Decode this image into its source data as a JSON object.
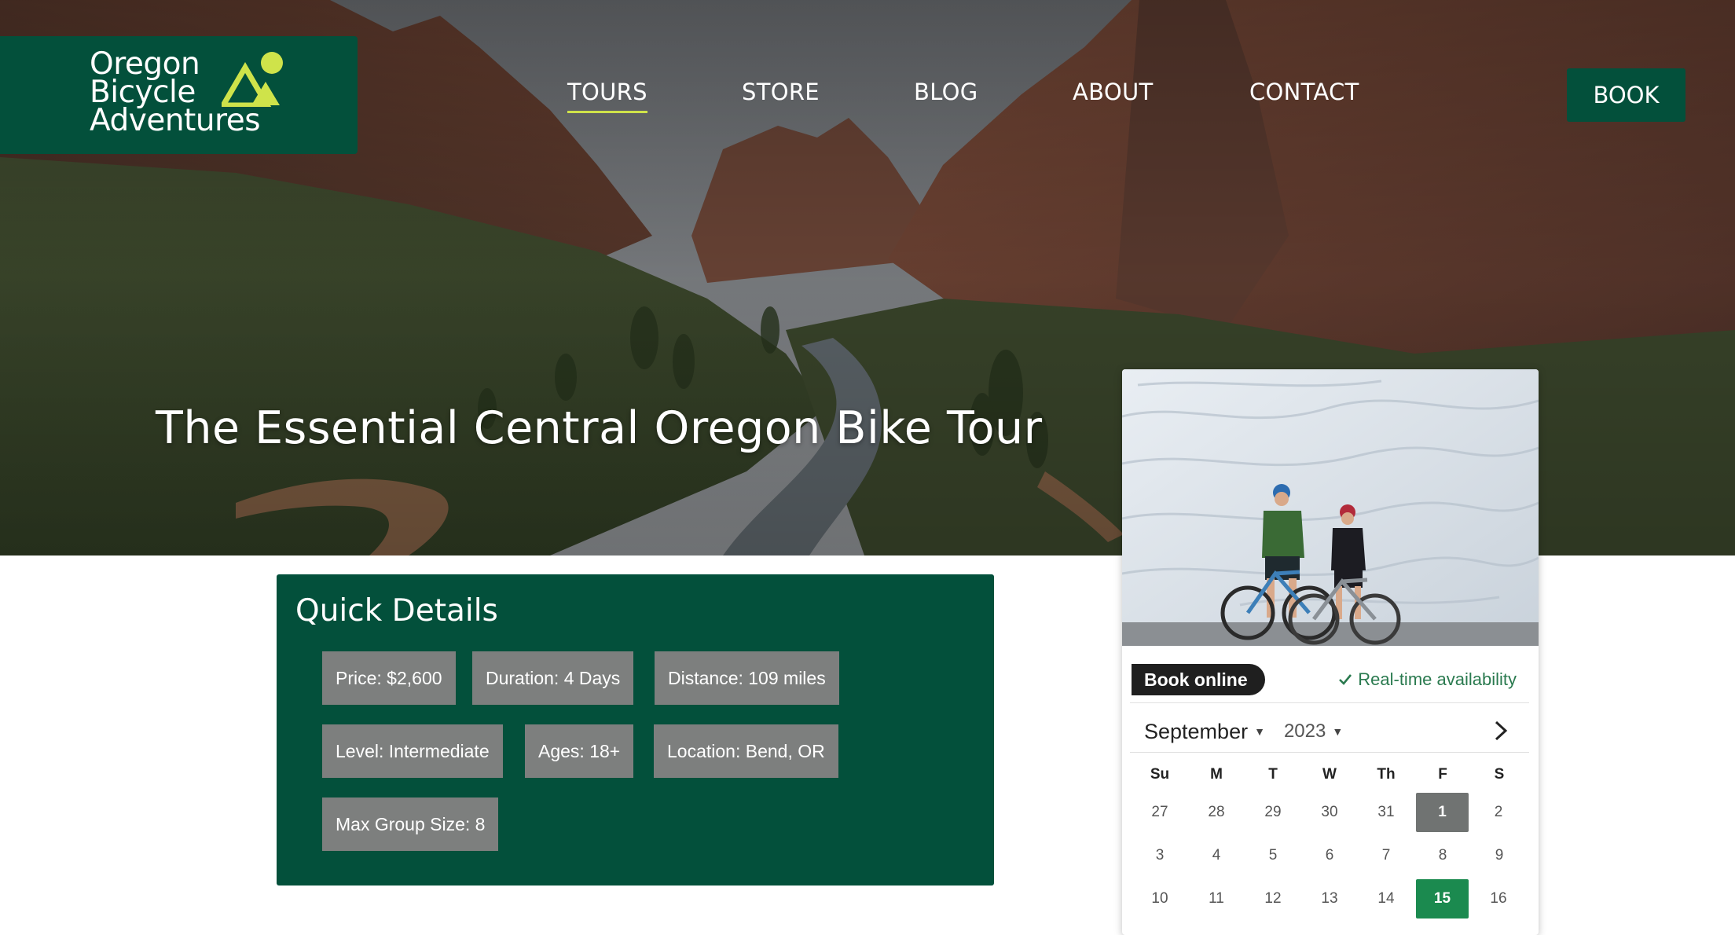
{
  "logo": {
    "lines": [
      "Oregon",
      "Bicycle",
      "Adventures"
    ]
  },
  "nav": {
    "items": [
      {
        "label": "TOURS",
        "active": true
      },
      {
        "label": "STORE",
        "active": false
      },
      {
        "label": "BLOG",
        "active": false
      },
      {
        "label": "ABOUT",
        "active": false
      },
      {
        "label": "CONTACT",
        "active": false
      }
    ],
    "book_label": "BOOK"
  },
  "hero": {
    "title": "The Essential Central Oregon Bike Tour"
  },
  "quick_details": {
    "title": "Quick Details",
    "chips": [
      "Price: $2,600",
      "Duration: 4 Days",
      "Distance: 109 miles",
      "Level: Intermediate",
      "Ages: 18+",
      "Location: Bend, OR",
      "Max Group Size: 8"
    ]
  },
  "booking": {
    "book_online": "Book online",
    "realtime": "Real-time availability",
    "month": "September",
    "year": "2023",
    "weekdays": [
      "Su",
      "M",
      "T",
      "W",
      "Th",
      "F",
      "S"
    ],
    "weeks": [
      [
        "27",
        "28",
        "29",
        "30",
        "31",
        "1",
        "2"
      ],
      [
        "3",
        "4",
        "5",
        "6",
        "7",
        "8",
        "9"
      ],
      [
        "10",
        "11",
        "12",
        "13",
        "14",
        "15",
        "16"
      ]
    ],
    "highlighted_gray": "1",
    "highlighted_green": "15"
  },
  "colors": {
    "brand_green": "#03503b",
    "accent_lime": "#cfe34a",
    "chip_gray": "#7d7f7e",
    "avail_green": "#1b8a4f"
  }
}
